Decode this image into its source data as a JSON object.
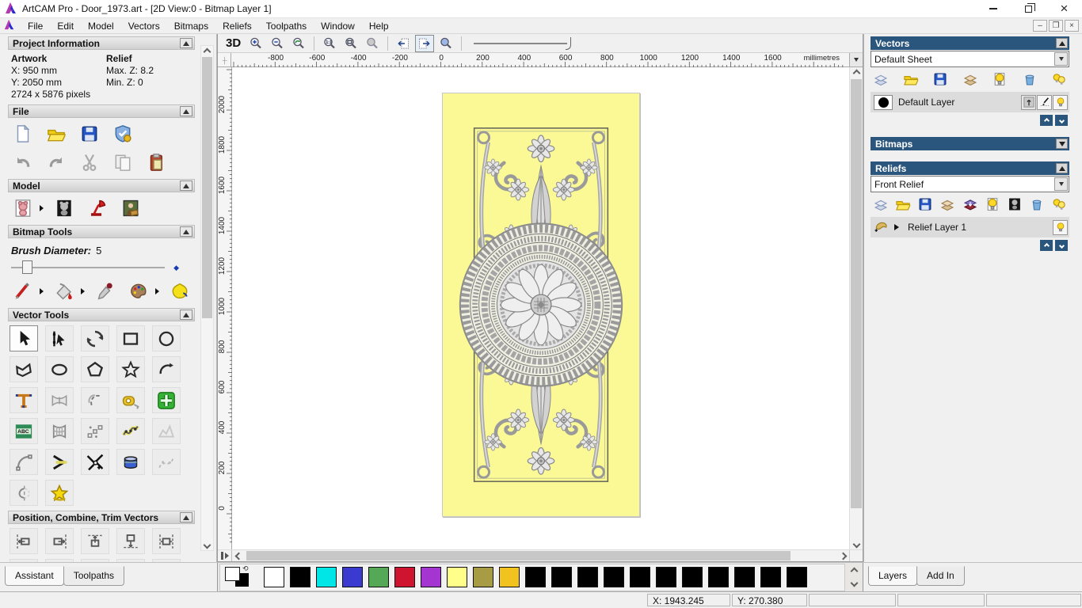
{
  "window": {
    "title": "ArtCAM Pro - Door_1973.art - [2D View:0 - Bitmap Layer 1]",
    "controls": [
      "minimize",
      "restore",
      "close"
    ]
  },
  "menu": {
    "items": [
      "File",
      "Edit",
      "Model",
      "Vectors",
      "Bitmaps",
      "Reliefs",
      "Toolpaths",
      "Window",
      "Help"
    ]
  },
  "toolbar": {
    "threed_label": "3D",
    "items": [
      "threed",
      "zoom-in",
      "zoom-out",
      "zoom-previous",
      "sep",
      "zoom-1to1",
      "zoom-fit",
      "zoom-object",
      "sep",
      "prev-bitmap-layer",
      {
        "name": "next-bitmap-layer",
        "pressed": true
      },
      "preview-blend",
      "sep",
      "contrast-slider"
    ]
  },
  "ruler": {
    "unit": "millimetres",
    "h_ticks": [
      "-800",
      "-600",
      "-400",
      "-200",
      "0",
      "200",
      "400",
      "600",
      "800",
      "1000",
      "1200",
      "1400",
      "1600"
    ],
    "v_ticks": [
      "2000",
      "1800",
      "1600",
      "1400",
      "1200",
      "1000",
      "800",
      "600",
      "400",
      "200",
      "0"
    ]
  },
  "assistant": {
    "project_information": {
      "title": "Project Information",
      "artwork_label": "Artwork",
      "relief_label": "Relief",
      "x": "X: 950 mm",
      "y": "Y: 2050 mm",
      "pixels": "2724 x 5876 pixels",
      "max_z": "Max. Z: 8.2",
      "min_z": "Min. Z: 0"
    },
    "file": {
      "title": "File",
      "rows": [
        [
          "new-file",
          "open-file",
          "save-file",
          "model-properties"
        ],
        [
          "undo",
          "redo",
          "cut",
          "copy",
          "paste"
        ]
      ]
    },
    "model": {
      "title": "Model",
      "rows": [
        [
          {
            "name": "set-model-size",
            "flyout": true
          },
          "greyscale-model",
          "lighting",
          "load-image"
        ]
      ]
    },
    "bitmap_tools": {
      "title": "Bitmap Tools",
      "brush_label": "Brush Diameter:",
      "brush_value": "5",
      "rows": [
        [
          {
            "name": "paint-tool",
            "flyout": true
          },
          {
            "name": "flood-fill-tool",
            "flyout": true
          },
          "pick-colour-tool",
          {
            "name": "colour-palette-tool",
            "flyout": true
          },
          "paint-selected-tool"
        ]
      ]
    },
    "vector_tools": {
      "title": "Vector Tools",
      "rows": [
        [
          {
            "name": "select-tool",
            "pressed": true
          },
          "node-edit-tool",
          "transform-tool",
          "rect-tool",
          "circle-tool"
        ],
        [
          "polyline-tool",
          "ellipse-tool",
          "polygon-tool",
          "star-tool",
          "arc-tool"
        ],
        [
          "text-tool",
          "wrap-text-tool",
          "offset-tool",
          "measure-tool",
          "vector-doctor-tool"
        ],
        [
          "text-block-tool",
          "envelope-tool",
          "paste-along-curve-tool",
          "paste-on-wave-tool",
          "blend-spline-tool"
        ],
        [
          "fillet-tool",
          "bisector-tool",
          "trim-tool",
          "interactive-distortion-tool",
          "free-spline-tool"
        ],
        [
          "mirror-tool",
          "wrap-star-tool"
        ]
      ]
    },
    "position": {
      "title": "Position, Combine, Trim Vectors",
      "rows": [
        [
          "align-left",
          "align-right",
          "align-top",
          "align-bottom",
          "align-centre-h"
        ],
        [
          "align-top-b",
          "align-top-c",
          "align-top-d",
          "scatter-tool",
          "nesting-tool"
        ]
      ]
    },
    "tabs": [
      {
        "label": "Assistant",
        "active": true
      },
      {
        "label": "Toolpaths",
        "active": false
      }
    ]
  },
  "vectors_panel": {
    "title": "Vectors",
    "sheet": "Default Sheet",
    "toolbar": [
      "vector-layer-new",
      "vector-layer-open",
      "vector-layer-save",
      "vector-layer-merge",
      "vector-layer-visibility",
      "vector-layer-delete",
      "vector-layers-visibility-all"
    ],
    "layer": {
      "name": "Default Layer",
      "colour": "#000000"
    }
  },
  "bitmaps_panel": {
    "title": "Bitmaps"
  },
  "reliefs_panel": {
    "title": "Reliefs",
    "relief": "Front Relief",
    "toolbar": [
      "relief-layer-new",
      "relief-layer-open",
      "relief-layer-save",
      "relief-layer-merge",
      "relief-transfer",
      "relief-layer-visibility",
      "relief-greyscale",
      "relief-layer-delete",
      "relief-layers-visibility-all"
    ],
    "layer": {
      "name": "Relief Layer 1"
    }
  },
  "right_tabs": [
    {
      "label": "Layers",
      "active": true
    },
    {
      "label": "Add In",
      "active": false
    }
  ],
  "palette": {
    "colors": [
      "#ffffff",
      "#000000",
      "#00e6e6",
      "#3a3ad0",
      "#55a855",
      "#cf1430",
      "#a435d0",
      "#ffff8a",
      "#a79b44",
      "#f2c21e",
      "#000000",
      "#000000",
      "#000000",
      "#000000",
      "#000000",
      "#000000",
      "#000000",
      "#000000",
      "#000000",
      "#000000",
      "#000000"
    ]
  },
  "status": {
    "x": "X: 1943.245",
    "y": "Y: 270.380"
  },
  "artwork": {
    "description": "Ornate carved door panel relief, grayscale scrollwork with central rosette medallion on yellow background",
    "background": "#fbf996"
  }
}
